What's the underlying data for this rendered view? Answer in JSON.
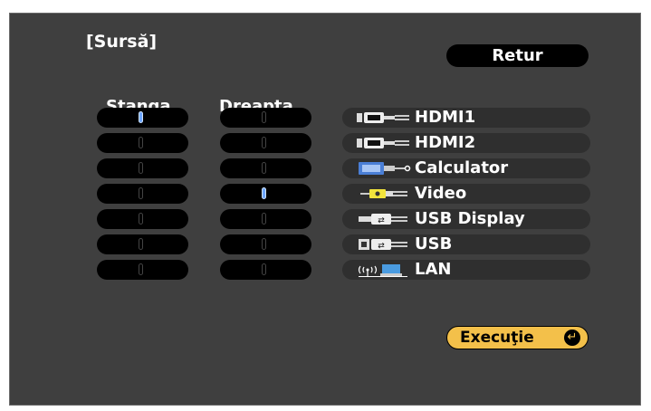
{
  "header": {
    "title": "[Sursă]",
    "back_button": "Retur"
  },
  "columns": {
    "left": "Stanga",
    "right": "Dreapta"
  },
  "rows": [
    {
      "source": "HDMI1",
      "icon": "hdmi-icon",
      "left_selected": true,
      "right_selected": false
    },
    {
      "source": "HDMI2",
      "icon": "hdmi-icon",
      "left_selected": false,
      "right_selected": false
    },
    {
      "source": "Calculator",
      "icon": "vga-computer-icon",
      "left_selected": false,
      "right_selected": false
    },
    {
      "source": "Video",
      "icon": "composite-video-icon",
      "left_selected": false,
      "right_selected": true
    },
    {
      "source": "USB Display",
      "icon": "usb-display-icon",
      "left_selected": false,
      "right_selected": false
    },
    {
      "source": "USB",
      "icon": "usb-icon",
      "left_selected": false,
      "right_selected": false
    },
    {
      "source": "LAN",
      "icon": "lan-wireless-icon",
      "left_selected": false,
      "right_selected": false
    }
  ],
  "footer": {
    "execute_button": "Execuţie"
  },
  "colors": {
    "background": "#3f3f3f",
    "indicator_on": "#6ea7ff",
    "execute": "#f3c04a"
  }
}
